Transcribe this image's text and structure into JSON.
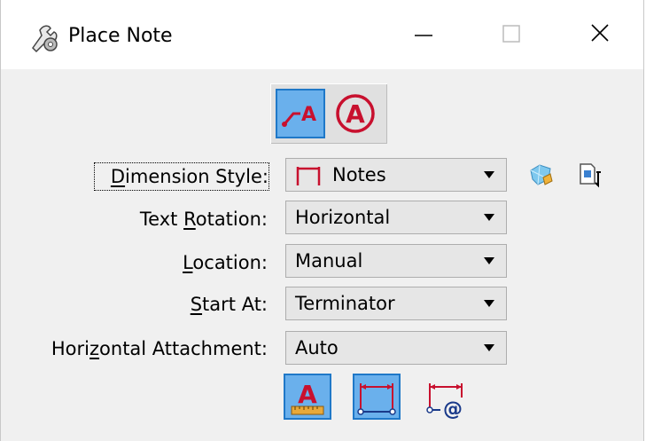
{
  "window": {
    "title": "Place Note",
    "app_icon": "place-note-tool-icon",
    "controls": {
      "minimize": "minimize-icon",
      "maximize": "maximize-icon",
      "close": "close-icon"
    }
  },
  "mode_buttons": [
    {
      "name": "leader-text-mode",
      "icon": "leader-with-text-icon",
      "selected": true
    },
    {
      "name": "circled-text-mode",
      "icon": "circled-a-icon",
      "selected": false
    }
  ],
  "fields": {
    "dimension_style": {
      "label_pre": "",
      "label_ul": "D",
      "label_post": "imension Style:",
      "value": "Notes",
      "icon": "dimension-style-icon"
    },
    "text_rotation": {
      "label_pre": "Text ",
      "label_ul": "R",
      "label_post": "otation:",
      "value": "Horizontal"
    },
    "location": {
      "label_pre": "",
      "label_ul": "L",
      "label_post": "ocation:",
      "value": "Manual"
    },
    "start_at": {
      "label_pre": "",
      "label_ul": "S",
      "label_post": "tart At:",
      "value": "Terminator"
    },
    "horizontal_attachment": {
      "label_pre": "Hori",
      "label_ul": "z",
      "label_post": "ontal Attachment:",
      "value": "Auto"
    }
  },
  "side_icons": [
    "style-gem-icon",
    "note-properties-icon"
  ],
  "bottom_buttons": [
    {
      "name": "text-settings",
      "icon": "text-a-ruler-icon",
      "selected": true
    },
    {
      "name": "leader-settings",
      "icon": "dimension-leader-icon",
      "selected": true
    },
    {
      "name": "attachment-settings",
      "icon": "dimension-at-icon",
      "selected": false
    }
  ],
  "colors": {
    "accent": "#1f78c8",
    "selected_fill": "#6ab0ec",
    "icon_red": "#c8102e"
  }
}
